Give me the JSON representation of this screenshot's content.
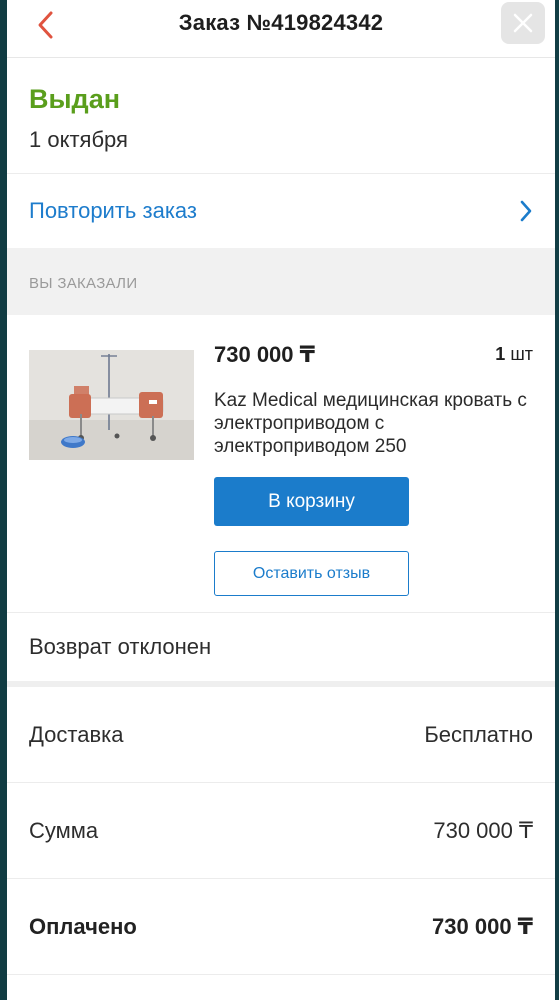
{
  "header": {
    "title": "Заказ №419824342",
    "back_icon": "chevron-left-icon",
    "close_icon": "close-icon"
  },
  "status": {
    "label": "Выдан",
    "date": "1 октября",
    "color": "#5a9e1c"
  },
  "repeat": {
    "label": "Повторить заказ",
    "icon": "chevron-right-icon"
  },
  "section": {
    "title": "ВЫ ЗАКАЗАЛИ"
  },
  "item": {
    "price": "730 000 ₸",
    "qty_number": "1",
    "qty_unit": "шт",
    "name": "Kaz Medical медицинская кровать с электроприводом с электроприводом 250",
    "cart_button": "В корзину",
    "review_button": "Оставить отзыв"
  },
  "return_status": "Возврат отклонен",
  "summary": [
    {
      "label": "Доставка",
      "value": "Бесплатно"
    },
    {
      "label": "Сумма",
      "value": "730 000 ₸"
    },
    {
      "label": "Оплачено",
      "value": "730 000 ₸"
    }
  ],
  "colors": {
    "accent": "#1b7ccb",
    "back_arrow": "#e0533f",
    "success": "#5a9e1c"
  }
}
